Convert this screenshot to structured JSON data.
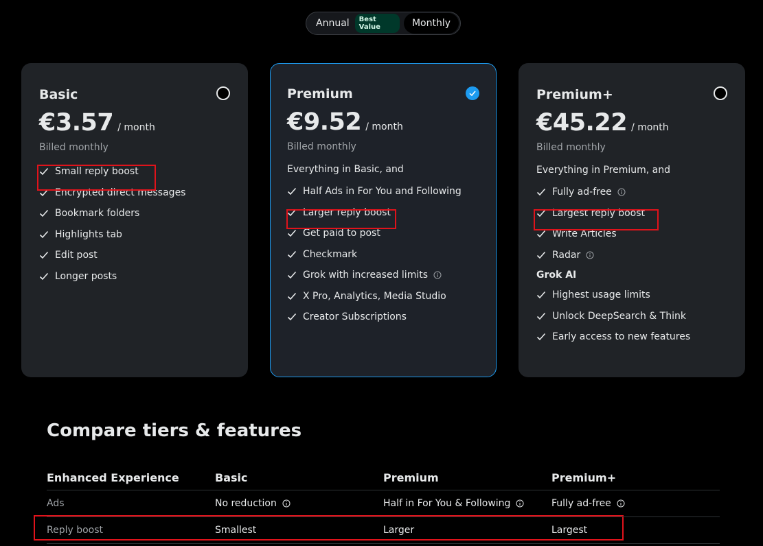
{
  "toggle": {
    "annual_label": "Annual",
    "badge": "Best Value",
    "monthly_label": "Monthly"
  },
  "plans": [
    {
      "name": "Basic",
      "price": "€3.57",
      "per": "/ month",
      "billed": "Billed monthly",
      "features": [
        "Small reply boost",
        "Encrypted direct messages",
        "Bookmark folders",
        "Highlights tab",
        "Edit post",
        "Longer posts"
      ]
    },
    {
      "name": "Premium",
      "price": "€9.52",
      "per": "/ month",
      "billed": "Billed monthly",
      "intro": "Everything in Basic, and",
      "features": [
        "Half Ads in For You and Following",
        "Larger reply boost",
        "Get paid to post",
        "Checkmark",
        "Grok with increased limits",
        "X Pro, Analytics, Media Studio",
        "Creator Subscriptions"
      ]
    },
    {
      "name": "Premium+",
      "price": "€45.22",
      "per": "/ month",
      "billed": "Billed monthly",
      "intro": "Everything in Premium, and",
      "features": [
        "Fully ad-free",
        "Largest reply boost",
        "Write Articles",
        "Radar"
      ],
      "section": "Grok AI",
      "section_features": [
        "Highest usage limits",
        "Unlock DeepSearch & Think",
        "Early access to new features"
      ]
    }
  ],
  "compare": {
    "title": "Compare tiers & features",
    "headers": [
      "Enhanced Experience",
      "Basic",
      "Premium",
      "Premium+"
    ],
    "rows": [
      {
        "label": "Ads",
        "values": [
          "No reduction",
          "Half in For You & Following",
          "Fully ad-free"
        ]
      },
      {
        "label": "Reply boost",
        "values": [
          "Smallest",
          "Larger",
          "Largest"
        ]
      }
    ]
  },
  "colors": {
    "accent": "#1d9bf0",
    "highlight": "#e0131b",
    "card_bg": "#202327"
  }
}
